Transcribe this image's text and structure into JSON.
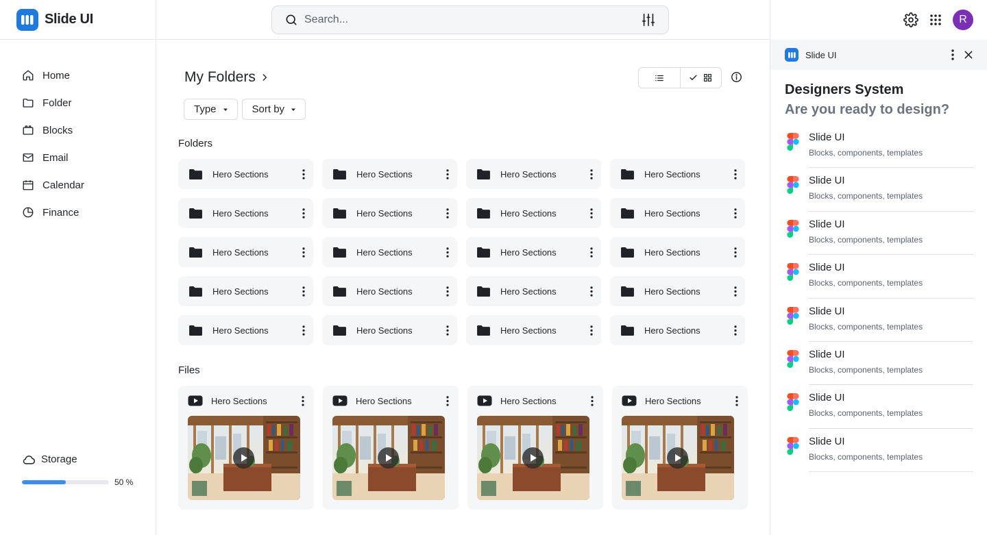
{
  "brand": {
    "name": "Slide UI",
    "accent": "#1f7ae0"
  },
  "search": {
    "placeholder": "Search..."
  },
  "sidebar": {
    "items": [
      {
        "label": "Home",
        "icon": "home-icon"
      },
      {
        "label": "Folder",
        "icon": "folder-icon"
      },
      {
        "label": "Blocks",
        "icon": "blocks-icon"
      },
      {
        "label": "Email",
        "icon": "mail-icon"
      },
      {
        "label": "Calendar",
        "icon": "calendar-icon"
      },
      {
        "label": "Finance",
        "icon": "pie-chart-icon"
      }
    ],
    "storage": {
      "label": "Storage",
      "percent": 50,
      "percent_label": "50 %"
    }
  },
  "main": {
    "title": "My Folders",
    "filters": {
      "type": "Type",
      "sort": "Sort by"
    },
    "view": {
      "active": "grid"
    },
    "folders_label": "Folders",
    "folders": [
      "Hero Sections",
      "Hero Sections",
      "Hero Sections",
      "Hero Sections",
      "Hero Sections",
      "Hero Sections",
      "Hero Sections",
      "Hero Sections",
      "Hero Sections",
      "Hero Sections",
      "Hero Sections",
      "Hero Sections",
      "Hero Sections",
      "Hero Sections",
      "Hero Sections",
      "Hero Sections",
      "Hero Sections",
      "Hero Sections",
      "Hero Sections",
      "Hero Sections"
    ],
    "files_label": "Files",
    "files": [
      "Hero Sections",
      "Hero Sections",
      "Hero Sections",
      "Hero Sections"
    ]
  },
  "user": {
    "initial": "R",
    "color": "#7b2fb5"
  },
  "panel": {
    "header": "Slide UI",
    "title": "Designers System",
    "subtitle": "Are you ready to design?",
    "items": [
      {
        "title": "Slide UI",
        "desc": "Blocks, components, templates"
      },
      {
        "title": "Slide UI",
        "desc": "Blocks, components, templates"
      },
      {
        "title": "Slide UI",
        "desc": "Blocks, components, templates"
      },
      {
        "title": "Slide UI",
        "desc": "Blocks, components, templates"
      },
      {
        "title": "Slide UI",
        "desc": "Blocks, components, templates"
      },
      {
        "title": "Slide UI",
        "desc": "Blocks, components, templates"
      },
      {
        "title": "Slide UI",
        "desc": "Blocks, components, templates"
      },
      {
        "title": "Slide UI",
        "desc": "Blocks, components, templates"
      }
    ]
  }
}
